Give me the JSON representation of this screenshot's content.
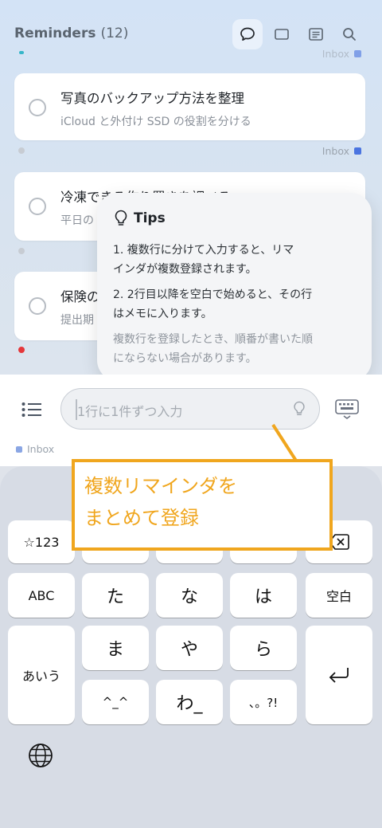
{
  "header": {
    "title": "Reminders",
    "count": "(12)"
  },
  "list_label": "Inbox",
  "reminders": [
    {
      "title": "写真のバックアップ方法を整理",
      "note": "iCloud と外付け SSD の役割を分ける"
    },
    {
      "title": "冷凍できる作り置きを調べる",
      "note": "平日の"
    },
    {
      "title": "保険の",
      "note": "提出期"
    }
  ],
  "tips": {
    "title": "Tips",
    "item1_line1": "1. 複数行に分けて入力すると、リマ",
    "item1_line2": "インダが複数登録されます。",
    "item2_line1": "2. 2行目以降を空白で始めると、その行",
    "item2_line2": "はメモに入ります。",
    "note_line1": "複数行を登録したとき、順番が書いた順",
    "note_line2": "にならない場合があります。"
  },
  "input": {
    "placeholder": "1行に1件ずつ入力"
  },
  "inbox_bottom": "Inbox",
  "callout": {
    "line1": "複数リマインダを",
    "line2": "まとめて登録"
  },
  "keyboard": {
    "k_123": "☆123",
    "k_abc": "ABC",
    "k_aiu": "あいう",
    "k_ta": "た",
    "k_na": "な",
    "k_ha": "は",
    "k_space": "空白",
    "k_ma": "ま",
    "k_ya": "や",
    "k_ra": "ら",
    "k_kao": "^_^",
    "k_wa": "わ_",
    "k_punct": "、。?!"
  },
  "colors": {
    "accent": "#4a74e0",
    "callout": "#f0a61e",
    "red_dot": "#e5373a"
  }
}
